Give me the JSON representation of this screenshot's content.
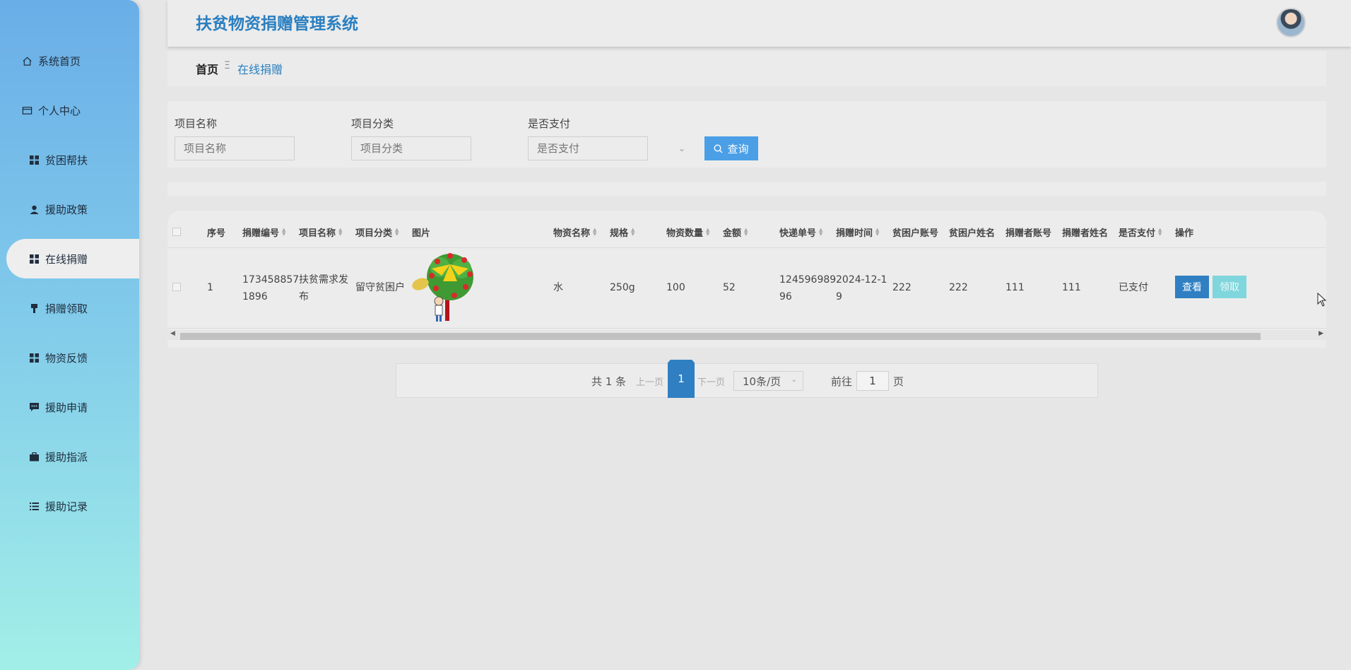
{
  "app": {
    "title": "扶贫物资捐赠管理系统"
  },
  "sidebar": {
    "items": [
      {
        "label": "系统首页",
        "icon": "home-icon"
      },
      {
        "label": "个人中心",
        "icon": "wallet-icon"
      },
      {
        "label": "贫困帮扶",
        "icon": "grid-icon"
      },
      {
        "label": "援助政策",
        "icon": "user-icon"
      },
      {
        "label": "在线捐赠",
        "icon": "grid-icon",
        "active": true
      },
      {
        "label": "捐赠领取",
        "icon": "marker-icon"
      },
      {
        "label": "物资反馈",
        "icon": "grid-icon"
      },
      {
        "label": "援助申请",
        "icon": "chat-icon"
      },
      {
        "label": "援助指派",
        "icon": "briefcase-icon"
      },
      {
        "label": "援助记录",
        "icon": "list-icon"
      }
    ]
  },
  "breadcrumb": {
    "home": "首页",
    "separator": "Ξ",
    "current": "在线捐赠"
  },
  "search": {
    "fields": [
      {
        "label": "项目名称",
        "placeholder": "项目名称"
      },
      {
        "label": "项目分类",
        "placeholder": "项目分类"
      },
      {
        "label": "是否支付",
        "placeholder": "是否支付"
      }
    ],
    "query_label": "查询"
  },
  "table": {
    "columns": [
      "序号",
      "捐赠编号",
      "项目名称",
      "项目分类",
      "图片",
      "物资名称",
      "规格",
      "物资数量",
      "金额",
      "快递单号",
      "捐赠时间",
      "贫困户账号",
      "贫困户姓名",
      "捐赠者账号",
      "捐赠者姓名",
      "是否支付",
      "操作"
    ],
    "rows": [
      {
        "index": "1",
        "donation_no": [
          "173458857",
          "1896"
        ],
        "project_name": [
          "扶贫需求发",
          "布"
        ],
        "category": "留守贫困户",
        "material": "水",
        "spec": "250g",
        "quantity": "100",
        "amount": "52",
        "express_no": [
          "124596989",
          "96"
        ],
        "time": [
          "2024-12-1",
          "9"
        ],
        "poor_account": "222",
        "poor_name": "222",
        "donor_account": "111",
        "donor_name": "111",
        "paid": "已支付",
        "view_label": "查看",
        "claim_label": "领取"
      }
    ]
  },
  "pagination": {
    "total": "共 1 条",
    "prev": "上一页",
    "current": "1",
    "next": "下一页",
    "page_size": "10条/页",
    "goto": "前往",
    "goto_value": "1",
    "page_unit": "页"
  },
  "colors": {
    "accent": "#2f7fc2",
    "title": "#2a7fc0",
    "query_button": "#4a9fe6",
    "claim_button": "#7fd6dc"
  }
}
